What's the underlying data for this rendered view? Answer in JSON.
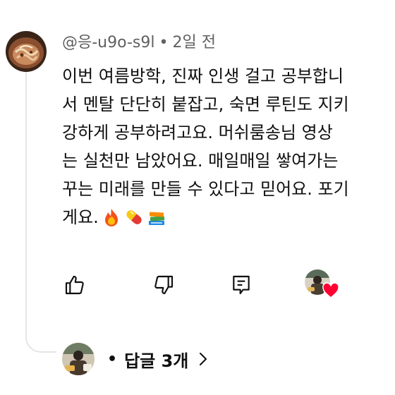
{
  "comment": {
    "author": "@응-u9o-s9l",
    "separator": "•",
    "time": "2일 전",
    "lines": [
      "이번 여름방학, 진짜 인생 걸고 공부합니",
      "서 멘탈 단단히 붙잡고, 숙면 루틴도 지키",
      "강하게 공부하려고요. 머쉬룸송님 영상",
      "는 실천만 남았어요. 매일매일 쌓여가는",
      "꾸는 미래를 만들 수 있다고 믿어요. 포기",
      "게요."
    ],
    "emojis": [
      "fire-emoji",
      "pill-emoji",
      "books-emoji"
    ]
  },
  "actions": {
    "like_icon": "thumbs-up-icon",
    "dislike_icon": "thumbs-down-icon",
    "reply_icon": "comment-icon",
    "creator_heart": "creator-heart-icon",
    "heart_color": "#ff0033"
  },
  "replies": {
    "bullet": "•",
    "label": "답글 3개",
    "chevron_icon": "chevron-right-icon"
  }
}
